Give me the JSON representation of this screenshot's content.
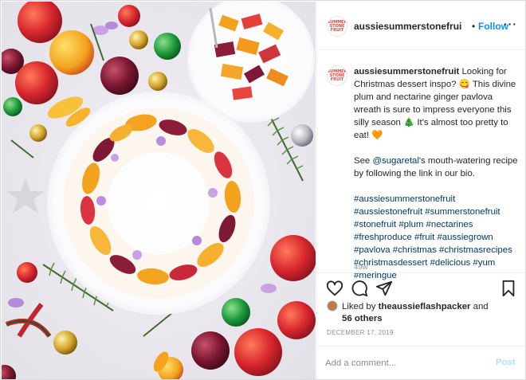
{
  "post": {
    "username": "aussiesummerstonefrui",
    "dot": "•",
    "follow_label": "Follow",
    "more_label": "···",
    "avatar_logo_line1": "SUMMER",
    "avatar_logo_line2": "STONE",
    "avatar_logo_line3": "FRUIT",
    "avatar_icon": "brand-logo-icon"
  },
  "caption": {
    "username": "aussiesummerstonefruit",
    "text_1": " Looking for Christmas dessert inspo? 😋 This divine plum and nectarine ginger pavlova wreath is sure to impress everyone this silly season 🎄 It's almost too pretty to eat! 🧡",
    "see_prefix": "See ",
    "mention": "@sugaretal",
    "see_suffix": "'s mouth-watering recipe by following the link in our bio.",
    "hashtags": "#aussiesummerstonefruit #aussiestonefruit #summerstonefruit #stonefruit #plum #nectarines #freshproduce #fruit #aussiegrown #pavlova #christmas #christmasrecipes #christmasdessert #delicious #yum #meringue",
    "age": "49w"
  },
  "actions": {
    "like_icon": "heart-icon",
    "comment_icon": "comment-icon",
    "share_icon": "share-icon",
    "save_icon": "bookmark-icon",
    "liked_by_prefix": "Liked by ",
    "liked_by_user": "theaussieflashpacker",
    "liked_by_and": " and",
    "liked_by_others": "56 others",
    "date": "DECEMBER 17, 2019"
  },
  "comment": {
    "placeholder": "Add a comment...",
    "post_label": "Post"
  },
  "colors": {
    "link": "#0095f6",
    "hashtag": "#00376b",
    "muted": "#8e8e8e",
    "post_disabled": "#b2dffc"
  },
  "photo": {
    "subject": "plum-nectarine-pavlova-wreath-photo"
  }
}
